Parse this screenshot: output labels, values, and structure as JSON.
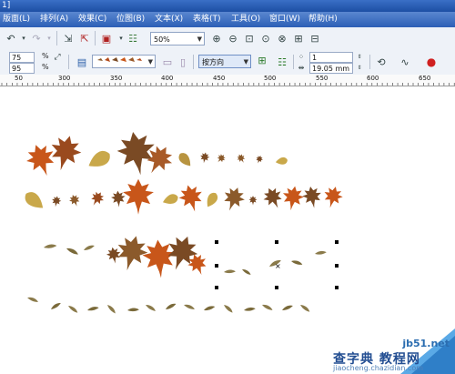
{
  "window": {
    "title_fragment": "1]"
  },
  "menu": [
    {
      "label": "版面(L)"
    },
    {
      "label": "排列(A)"
    },
    {
      "label": "效果(C)"
    },
    {
      "label": "位图(B)"
    },
    {
      "label": "文本(X)"
    },
    {
      "label": "表格(T)"
    },
    {
      "label": "工具(O)"
    },
    {
      "label": "窗口(W)"
    },
    {
      "label": "帮助(H)"
    }
  ],
  "toolbar": {
    "zoom_value": "50%",
    "text_input": "▲"
  },
  "property_bar": {
    "width_value": "75",
    "height_value": "95",
    "percent_unit": "%",
    "mode_value": "按方向",
    "steps_value": "1",
    "spacing_value": "19.05 mm"
  },
  "ruler": {
    "labels": [
      "50",
      "300",
      "350",
      "400",
      "450",
      "500",
      "550",
      "600",
      "650"
    ]
  },
  "watermark": {
    "site": "jb51.net",
    "brand": "查字典 教程网",
    "url": "jiaocheng.chazidian.com"
  },
  "colors": {
    "menubar": "#2c5fb6",
    "toolbar_bg": "#eef2f8",
    "leaf_orange": "#c8561a",
    "leaf_brown": "#7a4a24",
    "leaf_yellow": "#c9a84a"
  }
}
